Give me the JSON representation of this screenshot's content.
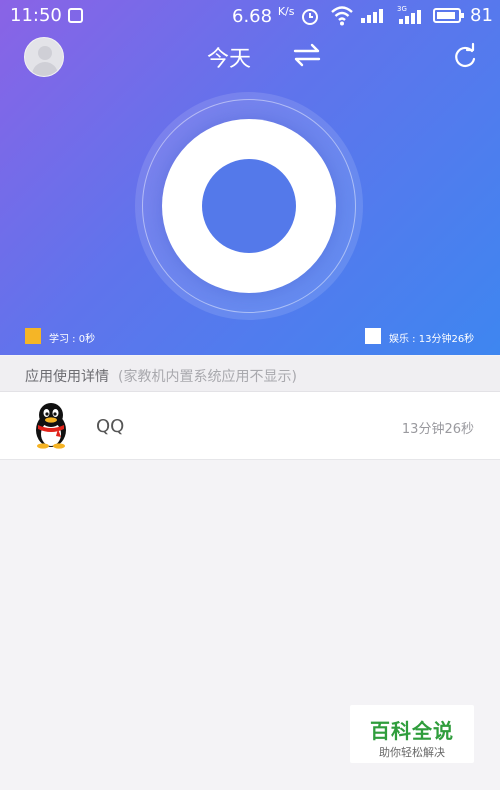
{
  "status_bar": {
    "time": "11:50",
    "network_speed": "6.68",
    "network_unit": "K/s",
    "network_type": "3G",
    "battery": "81"
  },
  "header": {
    "title": "今天",
    "icons": [
      "avatar",
      "swap-icon",
      "refresh-icon"
    ]
  },
  "usage_chart": {
    "type": "donut",
    "colors": {
      "study": "#f5b526",
      "entertainment": "#ffffff",
      "background": "#5479ea"
    }
  },
  "legend": {
    "study_label": "学习 : 0秒",
    "entertainment_label": "娱乐 : 13分钟26秒"
  },
  "section": {
    "title": "应用使用详情",
    "note": "(家教机内置系统应用不显示)"
  },
  "apps": [
    {
      "icon": "qq-penguin-icon",
      "name": "QQ",
      "duration": "13分钟26秒"
    }
  ],
  "watermark": {
    "title": "百科全说",
    "subtitle": "助你轻松解决"
  }
}
